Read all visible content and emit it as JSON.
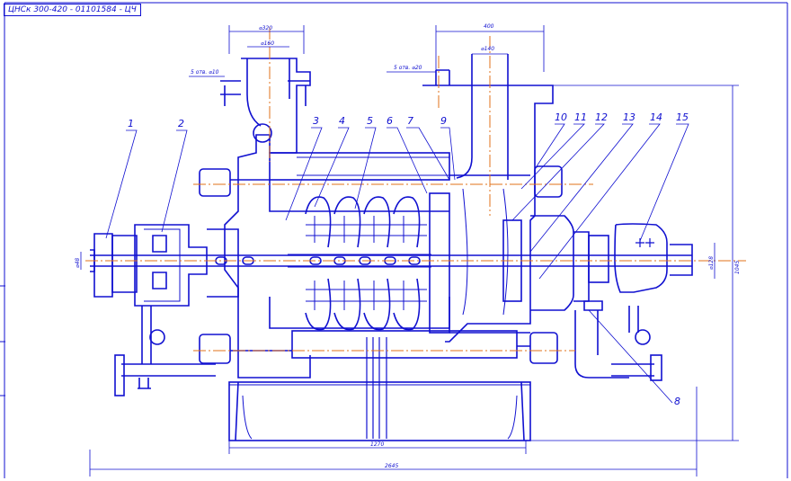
{
  "title": "ЦНСк 300-420 - 01101584 - ЦЧ",
  "colors": {
    "line": "#1010d0",
    "axis": "#e07018",
    "paper": "#ffffff"
  },
  "callouts": [
    "1",
    "2",
    "3",
    "4",
    "5",
    "6",
    "7",
    "9",
    "10",
    "11",
    "12",
    "13",
    "14",
    "15",
    "8"
  ],
  "dimensions": {
    "d320": "⌀320",
    "d160": "⌀160",
    "holes_left": "5 отв. ⌀10",
    "width_400": "400",
    "d140": "⌀140",
    "holes_right": "5 отв. ⌀20",
    "shaft_left": "⌀48",
    "shaft_right": "⌀128",
    "height_right": "1045",
    "base_length": "1270",
    "overall_length": "2645"
  }
}
